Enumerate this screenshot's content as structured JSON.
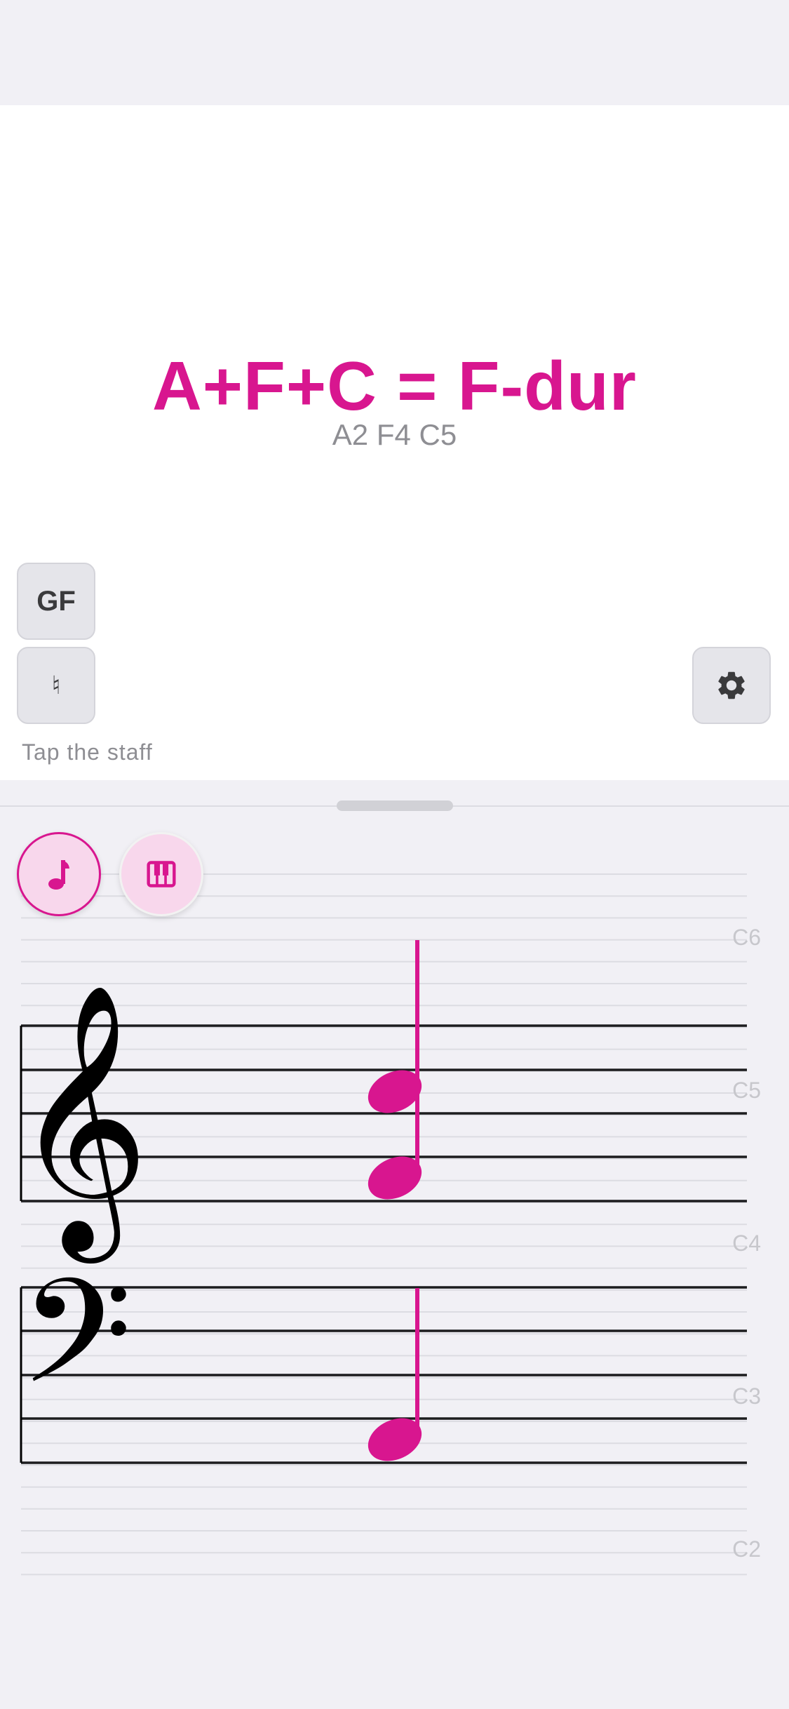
{
  "colors": {
    "accent": "#d8168f",
    "button_bg": "#e5e5ea",
    "panel_bg": "#ffffff",
    "sheet_bg": "#f1f0f5"
  },
  "chord": {
    "title": "A+F+C = F-dur",
    "notes": "A2 F4 C5"
  },
  "buttons": {
    "notation_label": "GF",
    "accidental_label": "♮",
    "settings_icon": "gear-icon"
  },
  "hint": "Tap the staff",
  "mode": {
    "notes_icon": "music-note-icon",
    "piano_icon": "piano-keys-icon",
    "selected": "notes"
  },
  "staff": {
    "octave_labels": [
      "C6",
      "C5",
      "C4",
      "C3",
      "C2"
    ],
    "treble_clef": "𝄞",
    "bass_clef": "𝄢",
    "placed_notes": [
      "C5",
      "F4",
      "A2"
    ]
  }
}
